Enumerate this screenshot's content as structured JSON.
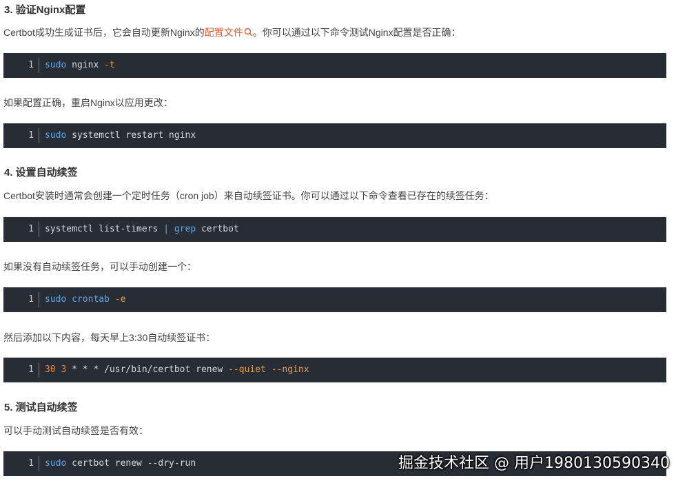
{
  "sections": {
    "s3": {
      "heading": "3. 验证Nginx配置",
      "intro_pre": "Certbot成功生成证书后，它会自动更新Nginx的",
      "intro_link": "配置文件",
      "intro_post": "。你可以通过以下命令测试Nginx配置是否正确：",
      "code1": {
        "ln": "1",
        "t1": "sudo",
        "t2": " nginx ",
        "t3": "-t"
      },
      "restart_text": "如果配置正确，重启Nginx以应用更改：",
      "code2": {
        "ln": "1",
        "t1": "sudo",
        "t2": " systemctl restart nginx"
      }
    },
    "s4": {
      "heading": "4. 设置自动续签",
      "intro": "Certbot安装时通常会创建一个定时任务（cron job）来自动续签证书。你可以通过以下命令查看已存在的续签任务：",
      "code3": {
        "ln": "1",
        "t1": "systemctl list-timers ",
        "t2": "|",
        "t3": " ",
        "t4": "grep",
        "t5": " certbot"
      },
      "manual_text": "如果没有自动续签任务，可以手动创建一个：",
      "code4": {
        "ln": "1",
        "t1": "sudo",
        "t2": " ",
        "t3": "crontab",
        "t4": " ",
        "t5": "-e"
      },
      "add_text": "然后添加以下内容，每天早上3:30自动续签证书：",
      "code5": {
        "ln": "1",
        "t1": "30",
        "t2": " ",
        "t3": "3",
        "t4": " * * * /usr/bin/certbot renew ",
        "t5": "--quiet",
        "t6": " ",
        "t7": "--nginx"
      }
    },
    "s5": {
      "heading": "5. 测试自动续签",
      "intro": "可以手动测试自动续签是否有效：",
      "code6": {
        "ln": "1",
        "t1": "sudo",
        "t2": " certbot renew --dry-run"
      }
    }
  },
  "watermark": "掘金技术社区 @ 用户1980130590340",
  "colors": {
    "code_bg": "#282c34",
    "link": "#e35a2b",
    "keyword": "#61a7e8",
    "option": "#e5a04b"
  },
  "icons": {
    "link_icon": "search-icon"
  }
}
